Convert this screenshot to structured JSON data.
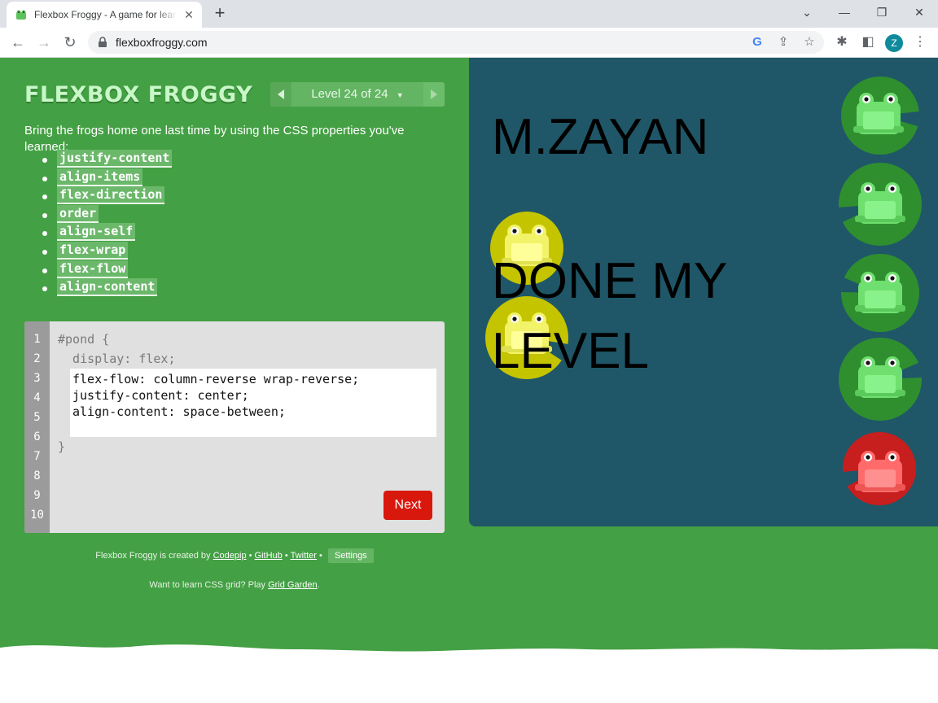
{
  "browser": {
    "tab_title": "Flexbox Froggy - A game for learning CSS flexbox",
    "url": "flexboxfroggy.com",
    "profile_initial": "Z"
  },
  "game": {
    "logo": "FLEXBOX FROGGY",
    "level_label": "Level 24 of 24",
    "instructions": "Bring the frogs home one last time by using the CSS properties you've learned:",
    "properties": [
      "justify-content",
      "align-items",
      "flex-direction",
      "order",
      "align-self",
      "flex-wrap",
      "flex-flow",
      "align-content"
    ],
    "editor": {
      "line_numbers": [
        "1",
        "2",
        "3",
        "4",
        "5",
        "6",
        "7",
        "8",
        "9",
        "10"
      ],
      "line1": "#pond {",
      "line2": "  display: flex;",
      "user_code": "flex-flow: column-reverse wrap-reverse;\njustify-content: center;\nalign-content: space-between;",
      "closing": "}",
      "next_label": "Next"
    },
    "credits": {
      "prefix": "Flexbox Froggy is created by",
      "codepip": "Codepip",
      "github": "GitHub",
      "twitter": "Twitter",
      "settings": "Settings"
    },
    "grid_promo": {
      "prefix": "Want to learn CSS grid? Play",
      "link": "Grid Garden"
    },
    "overlay": {
      "line1": "M.ZAYAN",
      "line2": "DONE MY LEVEL"
    }
  },
  "colors": {
    "page_green": "#44a044",
    "pond_blue": "#1f5768",
    "frog_green": "#6fe06f",
    "frog_yellow": "#f3f36a",
    "frog_red": "#ff6b6b",
    "next_red": "#d8180d"
  }
}
